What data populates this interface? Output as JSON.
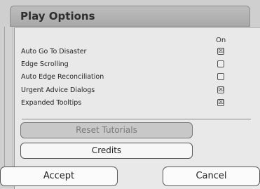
{
  "window": {
    "title": "Play Options"
  },
  "options": {
    "column_header": "On",
    "items": [
      {
        "label": "Auto Go To Disaster",
        "mark": "☒"
      },
      {
        "label": "Edge Scrolling",
        "mark": ""
      },
      {
        "label": "Auto Edge Reconciliation",
        "mark": ""
      },
      {
        "label": "Urgent Advice Dialogs",
        "mark": "☒"
      },
      {
        "label": "Expanded Tooltips",
        "mark": "☒"
      }
    ]
  },
  "buttons": {
    "reset_tutorials": "Reset Tutorials",
    "credits": "Credits",
    "accept": "Accept",
    "cancel": "Cancel"
  }
}
